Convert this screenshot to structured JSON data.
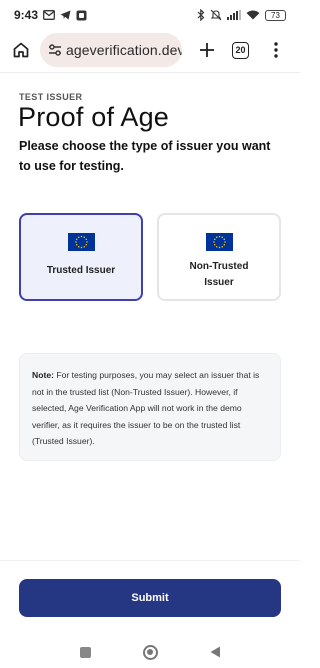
{
  "status_bar": {
    "time": "9:43",
    "battery": "73",
    "left_icons": [
      "mail-icon",
      "telegram-icon",
      "app-notification-icon"
    ],
    "right_icons": [
      "bluetooth-icon",
      "mute-icon",
      "signal-icon",
      "wifi-icon",
      "battery-icon"
    ]
  },
  "browser": {
    "url": "ageverification.dev",
    "tab_count": "20",
    "icons": [
      "home-icon",
      "site-settings-icon",
      "new-tab-icon",
      "tabs-icon",
      "menu-icon"
    ]
  },
  "page": {
    "eyebrow": "TEST ISSUER",
    "title": "Proof of Age",
    "subtitle": "Please choose the type of issuer you want to use for testing."
  },
  "issuer_options": [
    {
      "label": "Trusted Issuer",
      "selected": true,
      "icon": "eu-flag-icon"
    },
    {
      "label": "Non-Trusted Issuer",
      "selected": false,
      "icon": "eu-flag-icon"
    }
  ],
  "note": {
    "label": "Note:",
    "text": " For testing purposes, you may select an issuer that is not in the trusted list (Non-Trusted Issuer). However, if selected, Age Verification App will not work in the demo verifier, as it requires the issuer to be on the trusted list (Trusted Issuer)."
  },
  "submit": {
    "label": "Submit"
  },
  "colors": {
    "primary": "#253683",
    "selected_border": "#3f3fae",
    "selected_bg": "#eef0fb",
    "url_pill": "#f3e9e6",
    "eu_blue": "#003399",
    "eu_gold": "#ffcc00"
  }
}
